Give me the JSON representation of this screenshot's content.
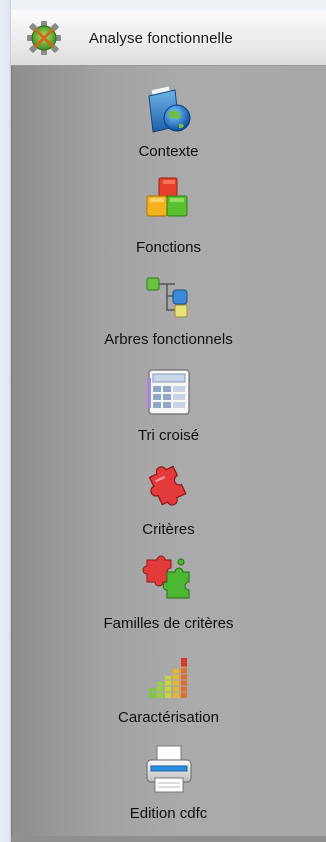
{
  "header": {
    "title": "Analyse fonctionnelle",
    "icon": "analysis-gear-icon"
  },
  "menu": {
    "items": [
      {
        "label": "Contexte",
        "icon": "globe-folder-icon"
      },
      {
        "label": "Fonctions",
        "icon": "cubes-icon"
      },
      {
        "label": "Arbres fonctionnels",
        "icon": "tree-icon"
      },
      {
        "label": "Tri croisé",
        "icon": "calculator-sheet-icon"
      },
      {
        "label": "Critères",
        "icon": "red-puzzle-icon"
      },
      {
        "label": "Familles de critères",
        "icon": "puzzle-pieces-icon"
      },
      {
        "label": "Caractérisation",
        "icon": "level-bars-icon"
      },
      {
        "label": "Edition cdfc",
        "icon": "printer-icon"
      }
    ]
  }
}
